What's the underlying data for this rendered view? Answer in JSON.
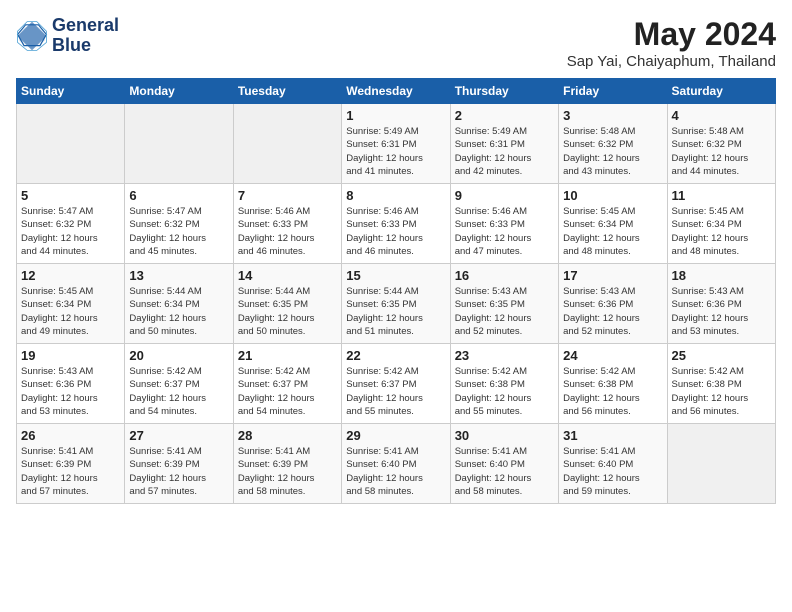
{
  "logo": {
    "line1": "General",
    "line2": "Blue"
  },
  "title": "May 2024",
  "subtitle": "Sap Yai, Chaiyaphum, Thailand",
  "days_of_week": [
    "Sunday",
    "Monday",
    "Tuesday",
    "Wednesday",
    "Thursday",
    "Friday",
    "Saturday"
  ],
  "weeks": [
    [
      {
        "day": "",
        "info": ""
      },
      {
        "day": "",
        "info": ""
      },
      {
        "day": "",
        "info": ""
      },
      {
        "day": "1",
        "info": "Sunrise: 5:49 AM\nSunset: 6:31 PM\nDaylight: 12 hours\nand 41 minutes."
      },
      {
        "day": "2",
        "info": "Sunrise: 5:49 AM\nSunset: 6:31 PM\nDaylight: 12 hours\nand 42 minutes."
      },
      {
        "day": "3",
        "info": "Sunrise: 5:48 AM\nSunset: 6:32 PM\nDaylight: 12 hours\nand 43 minutes."
      },
      {
        "day": "4",
        "info": "Sunrise: 5:48 AM\nSunset: 6:32 PM\nDaylight: 12 hours\nand 44 minutes."
      }
    ],
    [
      {
        "day": "5",
        "info": "Sunrise: 5:47 AM\nSunset: 6:32 PM\nDaylight: 12 hours\nand 44 minutes."
      },
      {
        "day": "6",
        "info": "Sunrise: 5:47 AM\nSunset: 6:32 PM\nDaylight: 12 hours\nand 45 minutes."
      },
      {
        "day": "7",
        "info": "Sunrise: 5:46 AM\nSunset: 6:33 PM\nDaylight: 12 hours\nand 46 minutes."
      },
      {
        "day": "8",
        "info": "Sunrise: 5:46 AM\nSunset: 6:33 PM\nDaylight: 12 hours\nand 46 minutes."
      },
      {
        "day": "9",
        "info": "Sunrise: 5:46 AM\nSunset: 6:33 PM\nDaylight: 12 hours\nand 47 minutes."
      },
      {
        "day": "10",
        "info": "Sunrise: 5:45 AM\nSunset: 6:34 PM\nDaylight: 12 hours\nand 48 minutes."
      },
      {
        "day": "11",
        "info": "Sunrise: 5:45 AM\nSunset: 6:34 PM\nDaylight: 12 hours\nand 48 minutes."
      }
    ],
    [
      {
        "day": "12",
        "info": "Sunrise: 5:45 AM\nSunset: 6:34 PM\nDaylight: 12 hours\nand 49 minutes."
      },
      {
        "day": "13",
        "info": "Sunrise: 5:44 AM\nSunset: 6:34 PM\nDaylight: 12 hours\nand 50 minutes."
      },
      {
        "day": "14",
        "info": "Sunrise: 5:44 AM\nSunset: 6:35 PM\nDaylight: 12 hours\nand 50 minutes."
      },
      {
        "day": "15",
        "info": "Sunrise: 5:44 AM\nSunset: 6:35 PM\nDaylight: 12 hours\nand 51 minutes."
      },
      {
        "day": "16",
        "info": "Sunrise: 5:43 AM\nSunset: 6:35 PM\nDaylight: 12 hours\nand 52 minutes."
      },
      {
        "day": "17",
        "info": "Sunrise: 5:43 AM\nSunset: 6:36 PM\nDaylight: 12 hours\nand 52 minutes."
      },
      {
        "day": "18",
        "info": "Sunrise: 5:43 AM\nSunset: 6:36 PM\nDaylight: 12 hours\nand 53 minutes."
      }
    ],
    [
      {
        "day": "19",
        "info": "Sunrise: 5:43 AM\nSunset: 6:36 PM\nDaylight: 12 hours\nand 53 minutes."
      },
      {
        "day": "20",
        "info": "Sunrise: 5:42 AM\nSunset: 6:37 PM\nDaylight: 12 hours\nand 54 minutes."
      },
      {
        "day": "21",
        "info": "Sunrise: 5:42 AM\nSunset: 6:37 PM\nDaylight: 12 hours\nand 54 minutes."
      },
      {
        "day": "22",
        "info": "Sunrise: 5:42 AM\nSunset: 6:37 PM\nDaylight: 12 hours\nand 55 minutes."
      },
      {
        "day": "23",
        "info": "Sunrise: 5:42 AM\nSunset: 6:38 PM\nDaylight: 12 hours\nand 55 minutes."
      },
      {
        "day": "24",
        "info": "Sunrise: 5:42 AM\nSunset: 6:38 PM\nDaylight: 12 hours\nand 56 minutes."
      },
      {
        "day": "25",
        "info": "Sunrise: 5:42 AM\nSunset: 6:38 PM\nDaylight: 12 hours\nand 56 minutes."
      }
    ],
    [
      {
        "day": "26",
        "info": "Sunrise: 5:41 AM\nSunset: 6:39 PM\nDaylight: 12 hours\nand 57 minutes."
      },
      {
        "day": "27",
        "info": "Sunrise: 5:41 AM\nSunset: 6:39 PM\nDaylight: 12 hours\nand 57 minutes."
      },
      {
        "day": "28",
        "info": "Sunrise: 5:41 AM\nSunset: 6:39 PM\nDaylight: 12 hours\nand 58 minutes."
      },
      {
        "day": "29",
        "info": "Sunrise: 5:41 AM\nSunset: 6:40 PM\nDaylight: 12 hours\nand 58 minutes."
      },
      {
        "day": "30",
        "info": "Sunrise: 5:41 AM\nSunset: 6:40 PM\nDaylight: 12 hours\nand 58 minutes."
      },
      {
        "day": "31",
        "info": "Sunrise: 5:41 AM\nSunset: 6:40 PM\nDaylight: 12 hours\nand 59 minutes."
      },
      {
        "day": "",
        "info": ""
      }
    ]
  ]
}
